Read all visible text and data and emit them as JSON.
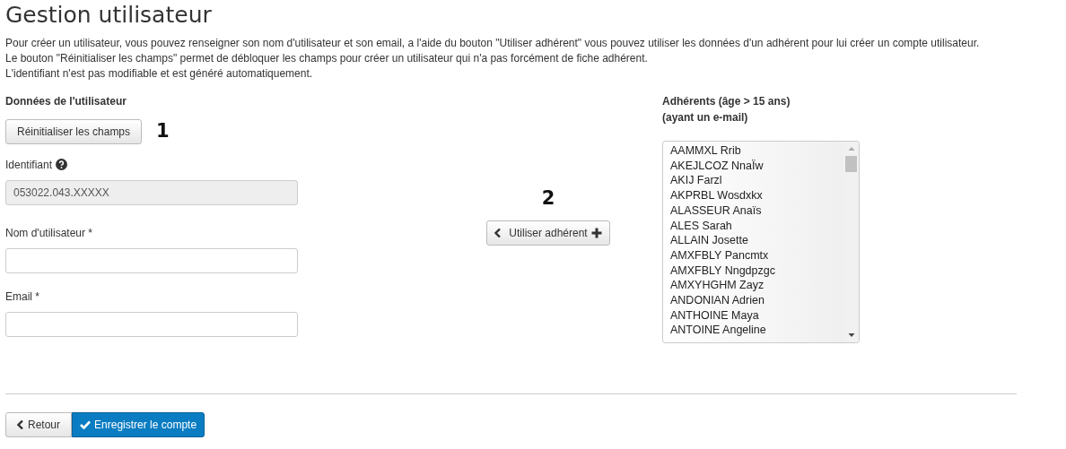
{
  "title": "Gestion utilisateur",
  "intro": [
    "Pour créer un utilisateur, vous pouvez renseigner son nom d'utilisateur et son email, a l'aide du bouton \"Utiliser adhérent\" vous pouvez utiliser les données d'un adhérent pour lui créer un compte utilisateur.",
    "Le bouton \"Réinitialiser les champs\" permet de débloquer les champs pour créer un utilisateur qui n'a pas forcément de fiche adhérent.",
    "L'identifiant n'est pas modifiable et est généré automatiquement."
  ],
  "user_section": {
    "heading": "Données de l'utilisateur",
    "reset_button": "Réinitialiser les champs",
    "reset_marker": "1",
    "fields": [
      {
        "label": "Identifiant",
        "help": true,
        "value": "053022.043.XXXXX",
        "disabled": true
      },
      {
        "label": "Nom d'utilisateur *",
        "help": false,
        "disabled": false
      },
      {
        "label": "Email *",
        "help": false,
        "disabled": false
      }
    ]
  },
  "use_member": {
    "marker": "2",
    "button": "Utiliser adhérent"
  },
  "members": {
    "heading": [
      "Adhérents (âge > 15 ans)",
      "(ayant un e-mail)"
    ],
    "items": [
      "AAMMXL Rrib",
      "AKEJLCOZ NnaÏw",
      "AKIJ Farzl",
      "AKPRBL Wosdxkx",
      "ALASSEUR Anaïs",
      "ALES Sarah",
      "ALLAIN Josette",
      "AMXFBLY Pancmtx",
      "AMXFBLY Nngdpzgc",
      "AMXYHGHM Zayz",
      "ANDONIAN Adrien",
      "ANTHOINE Maya",
      "ANTOINE Angeline"
    ]
  },
  "footer": {
    "back_button": "Retour",
    "save_button": "Enregistrer le compte"
  }
}
